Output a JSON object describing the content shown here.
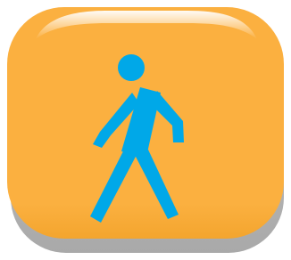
{
  "button": {
    "icon_name": "pedestrian-walking-icon",
    "colors": {
      "face": "#fbb040",
      "face_top_highlight": "#ffe6b8",
      "face_bottom": "#f3a52e",
      "base_shadow": "#c7c7c7",
      "base_shadow_dark": "#a9a9a9",
      "figure": "#00a8e8"
    }
  }
}
